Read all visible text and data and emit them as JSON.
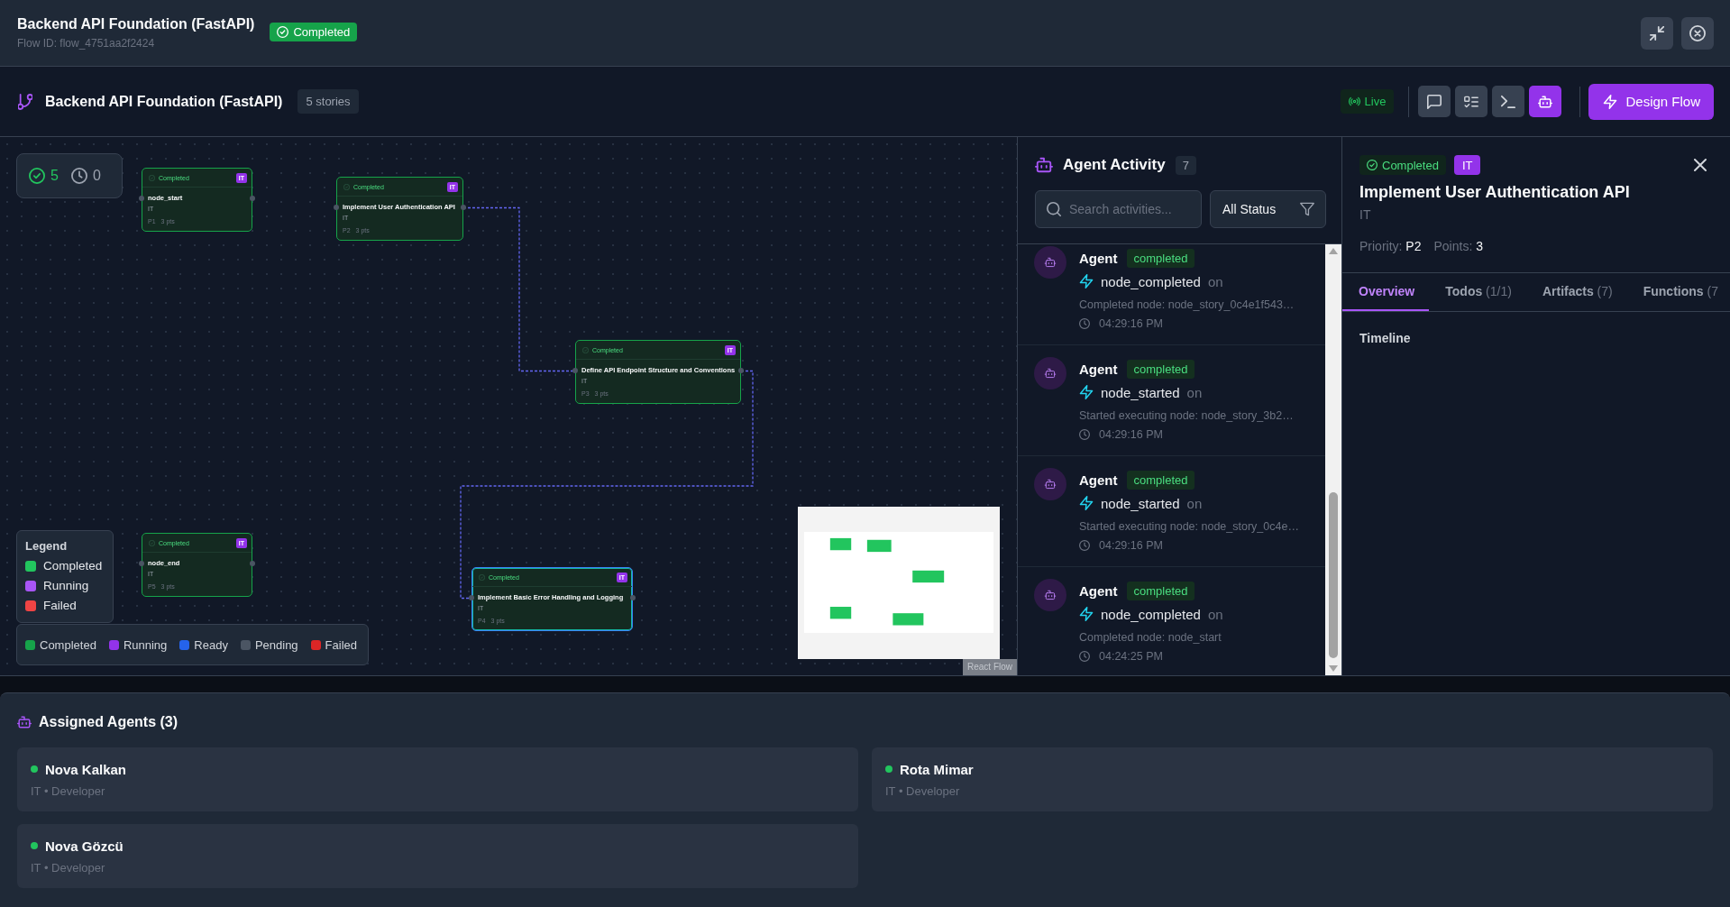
{
  "header": {
    "title": "Backend API Foundation (FastAPI)",
    "flow_id": "Flow ID: flow_4751aa2f2424",
    "status": "Completed"
  },
  "toolbar": {
    "title": "Backend API Foundation (FastAPI)",
    "stories": "5 stories",
    "live": "Live",
    "tools": [
      {
        "kind": "chat",
        "selected": false
      },
      {
        "kind": "tasks",
        "selected": false
      },
      {
        "kind": "terminal",
        "selected": false
      },
      {
        "kind": "bot",
        "selected": true
      }
    ],
    "design_button": "Design Flow"
  },
  "canvas": {
    "stats": {
      "completed": "5",
      "pending": "0"
    },
    "nodes": [
      {
        "status": "Completed",
        "tag": "IT",
        "title": "node_start",
        "team": "IT",
        "priority": "P1",
        "points": "3 pts",
        "selected": false
      },
      {
        "status": "Completed",
        "tag": "IT",
        "title": "Implement User Authentication API",
        "team": "IT",
        "priority": "P2",
        "points": "3 pts",
        "selected": false
      },
      {
        "status": "Completed",
        "tag": "IT",
        "title": "Define API Endpoint Structure and Conventions",
        "team": "IT",
        "priority": "P3",
        "points": "3 pts",
        "selected": false
      },
      {
        "status": "Completed",
        "tag": "IT",
        "title": "node_end",
        "team": "IT",
        "priority": "P5",
        "points": "3 pts",
        "selected": false
      },
      {
        "status": "Completed",
        "tag": "IT",
        "title": "Implement Basic Error Handling and Logging",
        "team": "IT",
        "priority": "P4",
        "points": "3 pts",
        "selected": true
      }
    ],
    "legend": {
      "title": "Legend",
      "items": [
        {
          "label": "Completed",
          "color": "#22c55e"
        },
        {
          "label": "Running",
          "color": "#a855f7"
        },
        {
          "label": "Failed",
          "color": "#ef4444"
        }
      ]
    },
    "status_key": [
      {
        "label": "Completed",
        "color": "#16a34a"
      },
      {
        "label": "Running",
        "color": "#9333ea"
      },
      {
        "label": "Ready",
        "color": "#2563eb"
      },
      {
        "label": "Pending",
        "color": "#4b5563"
      },
      {
        "label": "Failed",
        "color": "#dc2626"
      }
    ],
    "attribution": "React Flow"
  },
  "activity": {
    "title": "Agent Activity",
    "count": "7",
    "search": {
      "placeholder": "Search activities..."
    },
    "filter": "All Status",
    "items": [
      {
        "actor": "Agent",
        "status": "completed",
        "event": "node_completed",
        "preposition": "on",
        "description": "Completed node: node_story_0c4e1f543…",
        "time": "04:29:16 PM"
      },
      {
        "actor": "Agent",
        "status": "completed",
        "event": "node_started",
        "preposition": "on",
        "description": "Started executing node: node_story_3b2…",
        "time": "04:29:16 PM"
      },
      {
        "actor": "Agent",
        "status": "completed",
        "event": "node_started",
        "preposition": "on",
        "description": "Started executing node: node_story_0c4e…",
        "time": "04:29:16 PM"
      },
      {
        "actor": "Agent",
        "status": "completed",
        "event": "node_completed",
        "preposition": "on",
        "description": "Completed node: node_start",
        "time": "04:24:25 PM"
      }
    ]
  },
  "details": {
    "status": "Completed",
    "tag": "IT",
    "title": "Implement User Authentication API",
    "team": "IT",
    "priority": {
      "label": "Priority:",
      "value": "P2"
    },
    "points": {
      "label": "Points:",
      "value": "3"
    },
    "tabs": [
      {
        "label": "Overview",
        "selected": true
      },
      {
        "label": "Todos",
        "count": "(1/1)",
        "selected": false
      },
      {
        "label": "Artifacts",
        "count": "(7)",
        "selected": false
      },
      {
        "label": "Functions",
        "count": "(7",
        "selected": false
      }
    ],
    "section": "Timeline"
  },
  "assigned_agents": {
    "title": "Assigned Agents (3)",
    "agents": [
      {
        "name": "Nova Kalkan",
        "role": "IT • Developer",
        "online": true
      },
      {
        "name": "Rota Mimar",
        "role": "IT • Developer",
        "online": true
      },
      {
        "name": "Nova Gözcü",
        "role": "IT • Developer",
        "online": true
      }
    ]
  }
}
